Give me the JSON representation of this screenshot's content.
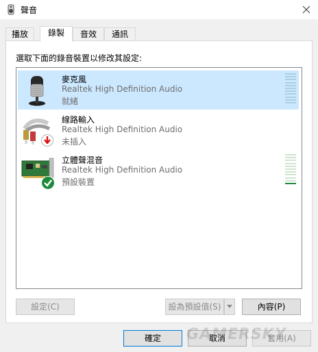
{
  "window": {
    "title": "聲音"
  },
  "tabs": [
    {
      "label": "播放"
    },
    {
      "label": "錄製"
    },
    {
      "label": "音效"
    },
    {
      "label": "通訊"
    }
  ],
  "panel": {
    "instruction": "選取下面的錄音裝置以修改其設定:"
  },
  "devices": [
    {
      "name": "麥克風",
      "description": "Realtek High Definition Audio",
      "status": "就緒",
      "icon": "microphone-icon",
      "level": 0
    },
    {
      "name": "線路輸入",
      "description": "Realtek High Definition Audio",
      "status": "未插入",
      "icon": "line-in-icon",
      "badge": "unplugged-badge-icon"
    },
    {
      "name": "立體聲混音",
      "description": "Realtek High Definition Audio",
      "status": "預設裝置",
      "icon": "sound-card-icon",
      "badge": "default-check-icon",
      "level": 0.05
    }
  ],
  "buttons": {
    "configure": "設定(C)",
    "set_default": "設為預設值(S)",
    "properties": "內容(P)",
    "ok": "確定",
    "cancel": "取消",
    "apply": "套用(A)"
  },
  "watermark": "GAMERSKY",
  "colors": {
    "selection": "#cce8ff",
    "accent": "#0078d7",
    "level_green": "#1e8a3c"
  }
}
